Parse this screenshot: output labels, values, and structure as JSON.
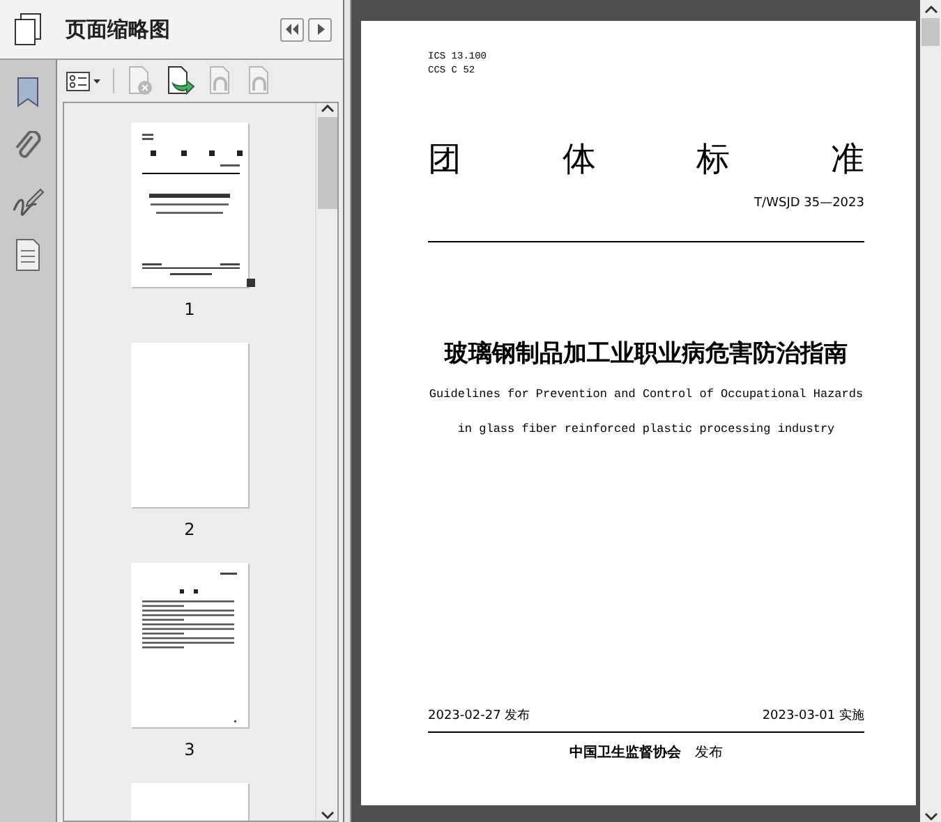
{
  "panel": {
    "title": "页面缩略图"
  },
  "rail": [
    {
      "kind": "bookmark"
    },
    {
      "kind": "attachment"
    },
    {
      "kind": "signature"
    },
    {
      "kind": "layers"
    }
  ],
  "toolbar": [
    {
      "kind": "options",
      "disabled": false
    },
    {
      "kind": "delete",
      "disabled": true
    },
    {
      "kind": "insert",
      "disabled": false
    },
    {
      "kind": "undo",
      "disabled": true
    },
    {
      "kind": "redo",
      "disabled": true
    }
  ],
  "thumbnails": [
    {
      "label": "1",
      "kind": "cover",
      "selected": true
    },
    {
      "label": "2",
      "kind": "blank",
      "selected": false
    },
    {
      "label": "3",
      "kind": "contents",
      "selected": false
    },
    {
      "kind": "blank"
    }
  ],
  "page": {
    "codes": [
      "ICS 13.100",
      "CCS C 52"
    ],
    "heading": [
      "团",
      "体",
      "标",
      "准"
    ],
    "number": "T/WSJD 35—2023",
    "title": "玻璃钢制品加工业职业病危害防治指南",
    "subtitle": [
      "Guidelines for Prevention and Control of Occupational Hazards",
      "in glass fiber reinforced plastic processing industry"
    ],
    "issued": "2023-02-27 发布",
    "effective": "2023-03-01 实施",
    "publisher": "中国卫生监督协会",
    "publisher_suffix": "发布"
  }
}
